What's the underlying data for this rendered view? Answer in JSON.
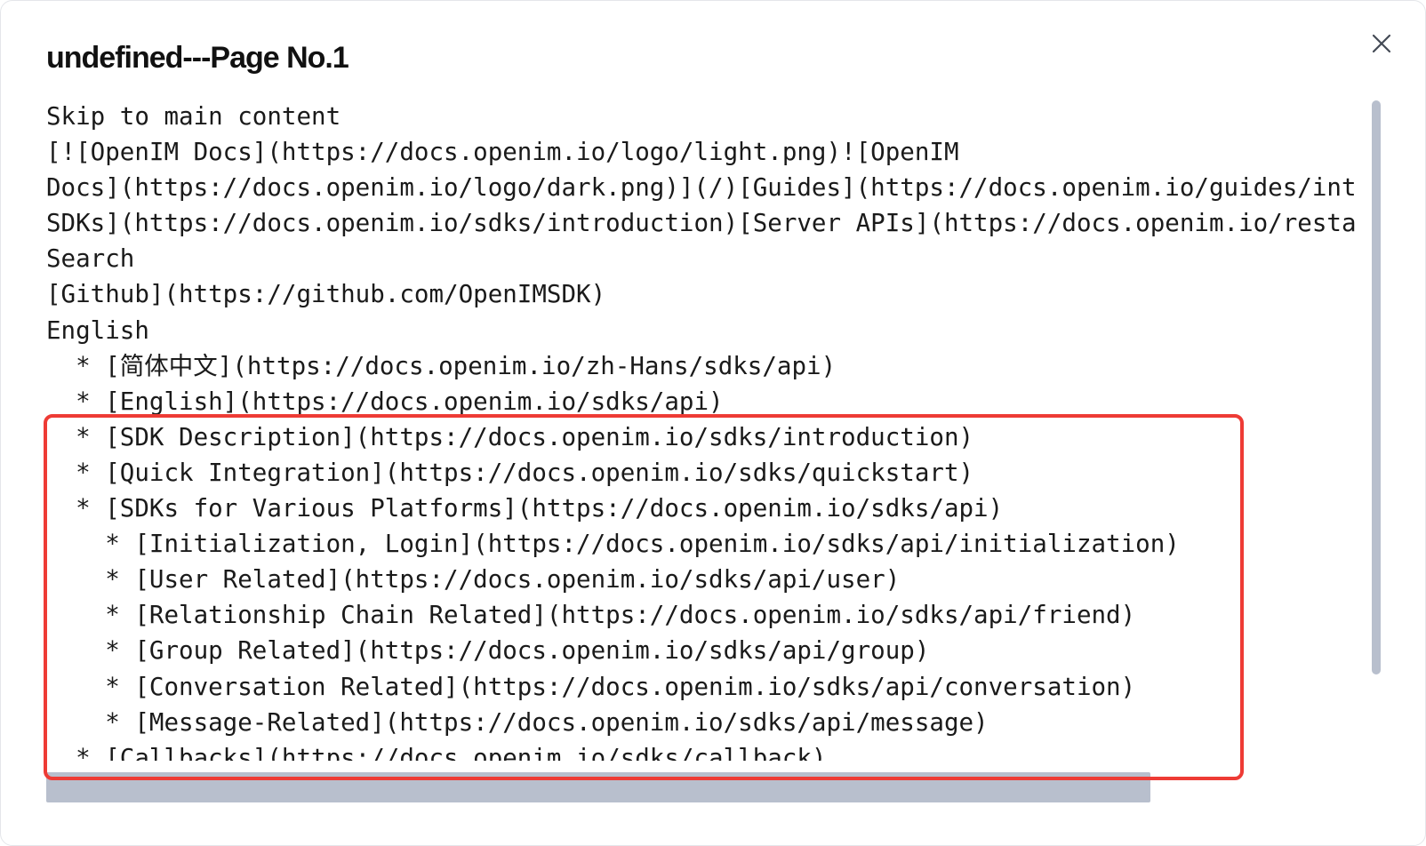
{
  "modal": {
    "title": "undefined---Page No.1",
    "close_icon": "close-icon"
  },
  "content": {
    "lines": [
      "Skip to main content",
      "[![OpenIM Docs](https://docs.openim.io/logo/light.png)![OpenIM",
      "Docs](https://docs.openim.io/logo/dark.png)](/)[Guides](https://docs.openim.io/guides/int",
      "SDKs](https://docs.openim.io/sdks/introduction)[Server APIs](https://docs.openim.io/resta",
      "Search",
      "[Github](https://github.com/OpenIMSDK)",
      "English",
      "  * [简体中文](https://docs.openim.io/zh-Hans/sdks/api)",
      "  * [English](https://docs.openim.io/sdks/api)",
      "  * [SDK Description](https://docs.openim.io/sdks/introduction)",
      "  * [Quick Integration](https://docs.openim.io/sdks/quickstart)",
      "  * [SDKs for Various Platforms](https://docs.openim.io/sdks/api)",
      "    * [Initialization, Login](https://docs.openim.io/sdks/api/initialization)",
      "    * [User Related](https://docs.openim.io/sdks/api/user)",
      "    * [Relationship Chain Related](https://docs.openim.io/sdks/api/friend)",
      "    * [Group Related](https://docs.openim.io/sdks/api/group)",
      "    * [Conversation Related](https://docs.openim.io/sdks/api/conversation)",
      "    * [Message-Related](https://docs.openim.io/sdks/api/message)",
      "  * [Callbacks](https://docs.openim.io/sdks/callback)"
    ]
  },
  "colors": {
    "highlight": "#ee3b35",
    "scrollbar": "#b8bfcd",
    "text": "#1a1a1a"
  }
}
